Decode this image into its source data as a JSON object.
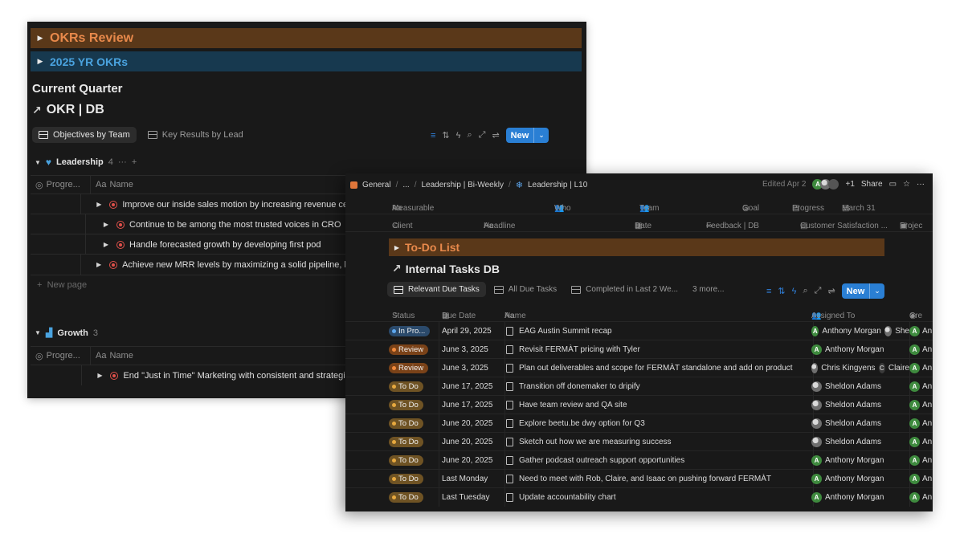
{
  "okr_window": {
    "toggle_okr_review": "OKRs Review",
    "toggle_yr_okrs": "2025 YR OKRs",
    "current_quarter": "Current Quarter",
    "db_title": "OKR | DB",
    "tabs": [
      "Objectives by Team",
      "Key Results by Lead"
    ],
    "new_label": "New",
    "group_leadership": {
      "name": "Leadership",
      "count": "4"
    },
    "columns": {
      "progress": "Progre...",
      "name": "Name"
    },
    "leadership_rows": [
      "Improve our inside sales motion by increasing revenue certaint",
      "Continue to be among the most trusted voices in CRO",
      "Handle forecasted growth by developing first pod",
      "Achieve new MRR levels by maximizing a solid pipeline, happy"
    ],
    "new_page": "New page",
    "group_growth": {
      "name": "Growth",
      "count": "3"
    },
    "growth_rows": [
      "End \"Just in Time\" Marketing with consistent and strategic cor"
    ]
  },
  "tasks_window": {
    "breadcrumbs": [
      "General",
      "...",
      "Leadership | Bi-Weekly",
      "Leadership | L10"
    ],
    "edited": "Edited Apr 2",
    "extra_count": "+1",
    "share": "Share",
    "props_row1": [
      "Measurable",
      "Who",
      "Team",
      "Goal",
      "Progress",
      "March 31"
    ],
    "props_row2": [
      "Client",
      "Headline",
      "Date",
      "Feedback | DB",
      "Customer Satisfaction ...",
      "Projec"
    ],
    "todo_toggle": "To-Do List",
    "db_title": "Internal Tasks DB",
    "tabs": [
      "Relevant Due Tasks",
      "All Due Tasks",
      "Completed in Last 2 We...",
      "3 more..."
    ],
    "new_label": "New",
    "columns": {
      "status": "Status",
      "due": "Due Date",
      "name": "Name",
      "assigned": "Assigned To",
      "created": "Cre"
    },
    "rows": [
      {
        "status": "In Pro...",
        "kind": "inprog",
        "due": "April 29, 2025",
        "name": "EAG Austin Summit recap",
        "assignee": "Anthony Morgan",
        "extra": "She",
        "av": "A",
        "creator": "An"
      },
      {
        "status": "Review",
        "kind": "review",
        "due": "June 3, 2025",
        "name": "Revisit FERMÀT pricing with Tyler",
        "assignee": "Anthony Morgan",
        "extra": "",
        "av": "A",
        "creator": "An"
      },
      {
        "status": "Review",
        "kind": "review",
        "due": "June 3, 2025",
        "name": "Plan out deliverables and scope for FERMÀT standalone and add on product",
        "assignee": "Chris Kingyens",
        "extra": "Claire",
        "av": "photo",
        "creator": "An"
      },
      {
        "status": "To Do",
        "kind": "todo",
        "due": "June 17, 2025",
        "name": "Transition off donemaker to dripify",
        "assignee": "Sheldon Adams",
        "extra": "",
        "av": "photo",
        "creator": "An"
      },
      {
        "status": "To Do",
        "kind": "todo",
        "due": "June 17, 2025",
        "name": "Have team review and QA site",
        "assignee": "Sheldon Adams",
        "extra": "",
        "av": "photo",
        "creator": "An"
      },
      {
        "status": "To Do",
        "kind": "todo",
        "due": "June 20, 2025",
        "name": "Explore beetu.be dwy option for Q3",
        "assignee": "Sheldon Adams",
        "extra": "",
        "av": "photo",
        "creator": "An"
      },
      {
        "status": "To Do",
        "kind": "todo",
        "due": "June 20, 2025",
        "name": "Sketch out how we are measuring success",
        "assignee": "Sheldon Adams",
        "extra": "",
        "av": "photo",
        "creator": "An"
      },
      {
        "status": "To Do",
        "kind": "todo",
        "due": "June 20, 2025",
        "name": "Gather podcast outreach support opportunities",
        "assignee": "Anthony Morgan",
        "extra": "",
        "av": "A",
        "creator": "An"
      },
      {
        "status": "To Do",
        "kind": "todo",
        "due": "Last Monday",
        "name": "Need to meet with Rob, Claire, and Isaac on pushing forward FERMÀT",
        "assignee": "Anthony Morgan",
        "extra": "",
        "av": "A",
        "creator": "An"
      },
      {
        "status": "To Do",
        "kind": "todo",
        "due": "Last Tuesday",
        "name": "Update accountability chart",
        "assignee": "Anthony Morgan",
        "extra": "",
        "av": "A",
        "creator": "An"
      }
    ]
  }
}
